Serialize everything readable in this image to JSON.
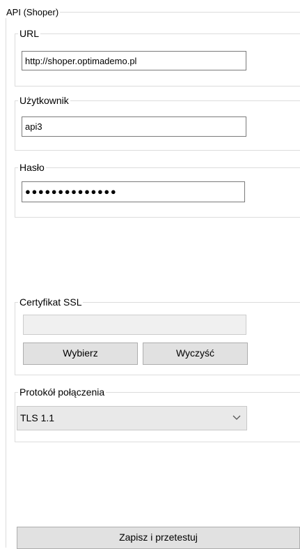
{
  "panel": {
    "title": "API (Shoper)"
  },
  "url": {
    "label": "URL",
    "value": "http://shoper.optimademo.pl"
  },
  "user": {
    "label": "Użytkownik",
    "value": "api3"
  },
  "password": {
    "label": "Hasło",
    "masked_value": "●●●●●●●●●●●●●●"
  },
  "ssl": {
    "label": "Certyfikat SSL",
    "value": "",
    "choose_label": "Wybierz",
    "clear_label": "Wyczyść"
  },
  "protocol": {
    "label": "Protokół połączenia",
    "selected": "TLS 1.1",
    "dropdown_icon": "chevron-down-icon"
  },
  "actions": {
    "save_test_label": "Zapisz i przetestuj"
  }
}
